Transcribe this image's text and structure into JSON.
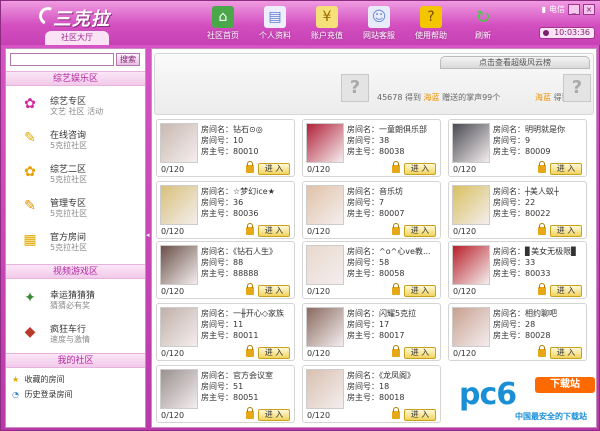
{
  "app": {
    "logo": "三克拉",
    "lobby_tab": "社区大厅"
  },
  "nav": [
    {
      "label": "社区首页",
      "icon": "home-icon",
      "color": "#4aa84a",
      "glyph": "⌂"
    },
    {
      "label": "个人资料",
      "icon": "profile-icon",
      "color": "#5a7fd0",
      "glyph": "▤"
    },
    {
      "label": "账户充值",
      "icon": "recharge-icon",
      "color": "#e0a800",
      "glyph": "¥"
    },
    {
      "label": "网站客服",
      "icon": "service-icon",
      "color": "#6a8ad6",
      "glyph": "☺"
    },
    {
      "label": "使用帮助",
      "icon": "help-icon",
      "color": "#e8b400",
      "glyph": "?"
    },
    {
      "label": "刷新",
      "icon": "refresh-icon",
      "color": "#3fa84a",
      "glyph": "↻"
    }
  ],
  "window": {
    "telecom": "电信",
    "minimize": "_",
    "close": "×",
    "clock": "10:03:36"
  },
  "sidebar": {
    "search_placeholder": "",
    "search_button": "搜索",
    "sections": [
      {
        "title": "综艺娱乐区"
      },
      {
        "title": "视频游戏区"
      },
      {
        "title": "我的社区"
      }
    ],
    "items": [
      {
        "name": "综艺专区",
        "sub": "文艺  社区  活动",
        "icon": "variety-icon",
        "glyph": "✿",
        "color": "#d4279b"
      },
      {
        "name": "在线咨询",
        "sub": "5克拉社区",
        "icon": "consult-icon",
        "glyph": "✎",
        "color": "#e0a800"
      },
      {
        "name": "综艺二区",
        "sub": "5克拉社区",
        "icon": "variety-two-icon",
        "glyph": "✿",
        "color": "#e8a000"
      },
      {
        "name": "管理专区",
        "sub": "5克拉社区",
        "icon": "manage-icon",
        "glyph": "✎",
        "color": "#e09000"
      },
      {
        "name": "官方房间",
        "sub": "5克拉社区",
        "icon": "official-room-icon",
        "glyph": "▦",
        "color": "#e0a800"
      },
      {
        "name": "幸运猜猜猜",
        "sub": "猜猜必有奖",
        "icon": "lucky-guess-icon",
        "glyph": "✦",
        "color": "#3a8a3a"
      },
      {
        "name": "疯狂车行",
        "sub": "速度与激情",
        "icon": "crazy-car-icon",
        "glyph": "◆",
        "color": "#b83a2a"
      }
    ],
    "links": [
      {
        "label": "收藏的房间",
        "icon": "star-icon",
        "glyph": "★"
      },
      {
        "label": "历史登录房间",
        "icon": "history-icon",
        "glyph": "◔"
      }
    ]
  },
  "banner": {
    "tab": "点击查看超级风云榜",
    "line_amount": "45678",
    "line_get": "得到",
    "line_name": "海蓝",
    "line_text": "赠送的掌声99个",
    "right_name": "海蓝",
    "right_get": "得到"
  },
  "rooms": [
    {
      "name": "房间名：钻石⊙◎",
      "number": "房间号：10",
      "owner": "房主号：80010",
      "count": "0/120",
      "enter": "进 入",
      "thumb": "#c9b8b0"
    },
    {
      "name": "房间名：一童朗俱乐部",
      "number": "房间号：38",
      "owner": "房主号：80038",
      "count": "0/120",
      "enter": "进 入",
      "thumb": "#b2203a"
    },
    {
      "name": "房间名：明明就是你",
      "number": "房间号：9",
      "owner": "房主号：80009",
      "count": "0/120",
      "enter": "进 入",
      "thumb": "#4a4a52"
    },
    {
      "name": "房间名：☆梦幻ice★",
      "number": "房间号：36",
      "owner": "房主号：80036",
      "count": "0/120",
      "enter": "进 入",
      "thumb": "#d7c07a"
    },
    {
      "name": "房间名：音乐坊",
      "number": "房间号：7",
      "owner": "房主号：80007",
      "count": "0/120",
      "enter": "进 入",
      "thumb": "#e0c2a8"
    },
    {
      "name": "房间名：┼美人蚁┼",
      "number": "房间号：22",
      "owner": "房主号：80022",
      "count": "0/120",
      "enter": "进 入",
      "thumb": "#d8c060"
    },
    {
      "name": "房间名：《钻石人生》",
      "number": "房间号：88",
      "owner": "房主号：88888",
      "count": "0/120",
      "enter": "进 入",
      "thumb": "#6a5048"
    },
    {
      "name": "房间名：^o^心ve教...",
      "number": "房间号：58",
      "owner": "房主号：80058",
      "count": "0/120",
      "enter": "进 入",
      "thumb": "#e8d8cc"
    },
    {
      "name": "房间名：▊美女无极限▊",
      "number": "房间号：33",
      "owner": "房主号：80033",
      "count": "0/120",
      "enter": "进 入",
      "thumb": "#b8202a"
    },
    {
      "name": "房间名：一╫开心◇家族",
      "number": "房间号：11",
      "owner": "房主号：80011",
      "count": "0/120",
      "enter": "进 入",
      "thumb": "#c0b0a8"
    },
    {
      "name": "房间名：闪耀5克拉",
      "number": "房间号：17",
      "owner": "房主号：80017",
      "count": "0/120",
      "enter": "进 入",
      "thumb": "#8a6a60"
    },
    {
      "name": "房间名：相约聊吧",
      "number": "房间号：28",
      "owner": "房主号：80028",
      "count": "0/120",
      "enter": "进 入",
      "thumb": "#c8a090"
    },
    {
      "name": "房间名：官方会议室",
      "number": "房间号：51",
      "owner": "房主号：80051",
      "count": "0/120",
      "enter": "进 入",
      "thumb": "#9a9090"
    },
    {
      "name": "房间名：《龙凤阁》",
      "number": "房间号：18",
      "owner": "房主号：80018",
      "count": "0/120",
      "enter": "进 入",
      "thumb": "#d8c0b0"
    }
  ],
  "watermark": {
    "logo": "pc6",
    "badge": "下载站",
    "sub": "中国最安全的下载站"
  }
}
